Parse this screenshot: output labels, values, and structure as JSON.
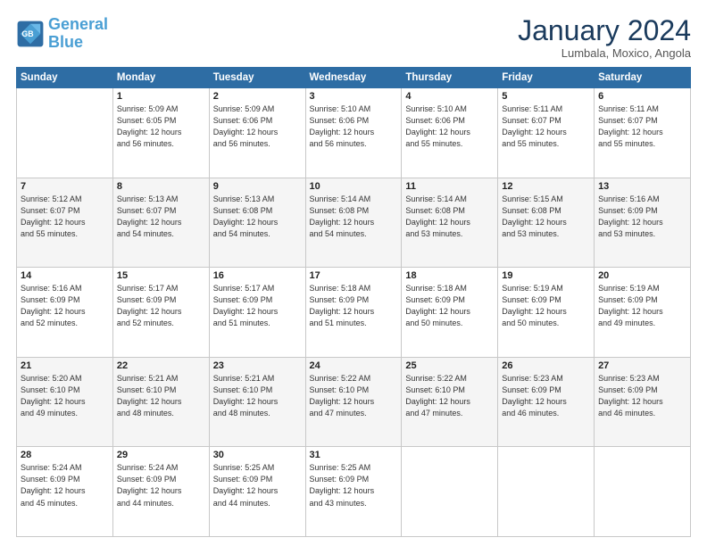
{
  "logo": {
    "line1": "General",
    "line2": "Blue"
  },
  "header": {
    "title": "January 2024",
    "subtitle": "Lumbala, Moxico, Angola"
  },
  "weekdays": [
    "Sunday",
    "Monday",
    "Tuesday",
    "Wednesday",
    "Thursday",
    "Friday",
    "Saturday"
  ],
  "weeks": [
    [
      {
        "day": "",
        "info": ""
      },
      {
        "day": "1",
        "info": "Sunrise: 5:09 AM\nSunset: 6:05 PM\nDaylight: 12 hours\nand 56 minutes."
      },
      {
        "day": "2",
        "info": "Sunrise: 5:09 AM\nSunset: 6:06 PM\nDaylight: 12 hours\nand 56 minutes."
      },
      {
        "day": "3",
        "info": "Sunrise: 5:10 AM\nSunset: 6:06 PM\nDaylight: 12 hours\nand 56 minutes."
      },
      {
        "day": "4",
        "info": "Sunrise: 5:10 AM\nSunset: 6:06 PM\nDaylight: 12 hours\nand 55 minutes."
      },
      {
        "day": "5",
        "info": "Sunrise: 5:11 AM\nSunset: 6:07 PM\nDaylight: 12 hours\nand 55 minutes."
      },
      {
        "day": "6",
        "info": "Sunrise: 5:11 AM\nSunset: 6:07 PM\nDaylight: 12 hours\nand 55 minutes."
      }
    ],
    [
      {
        "day": "7",
        "info": "Sunrise: 5:12 AM\nSunset: 6:07 PM\nDaylight: 12 hours\nand 55 minutes."
      },
      {
        "day": "8",
        "info": "Sunrise: 5:13 AM\nSunset: 6:07 PM\nDaylight: 12 hours\nand 54 minutes."
      },
      {
        "day": "9",
        "info": "Sunrise: 5:13 AM\nSunset: 6:08 PM\nDaylight: 12 hours\nand 54 minutes."
      },
      {
        "day": "10",
        "info": "Sunrise: 5:14 AM\nSunset: 6:08 PM\nDaylight: 12 hours\nand 54 minutes."
      },
      {
        "day": "11",
        "info": "Sunrise: 5:14 AM\nSunset: 6:08 PM\nDaylight: 12 hours\nand 53 minutes."
      },
      {
        "day": "12",
        "info": "Sunrise: 5:15 AM\nSunset: 6:08 PM\nDaylight: 12 hours\nand 53 minutes."
      },
      {
        "day": "13",
        "info": "Sunrise: 5:16 AM\nSunset: 6:09 PM\nDaylight: 12 hours\nand 53 minutes."
      }
    ],
    [
      {
        "day": "14",
        "info": "Sunrise: 5:16 AM\nSunset: 6:09 PM\nDaylight: 12 hours\nand 52 minutes."
      },
      {
        "day": "15",
        "info": "Sunrise: 5:17 AM\nSunset: 6:09 PM\nDaylight: 12 hours\nand 52 minutes."
      },
      {
        "day": "16",
        "info": "Sunrise: 5:17 AM\nSunset: 6:09 PM\nDaylight: 12 hours\nand 51 minutes."
      },
      {
        "day": "17",
        "info": "Sunrise: 5:18 AM\nSunset: 6:09 PM\nDaylight: 12 hours\nand 51 minutes."
      },
      {
        "day": "18",
        "info": "Sunrise: 5:18 AM\nSunset: 6:09 PM\nDaylight: 12 hours\nand 50 minutes."
      },
      {
        "day": "19",
        "info": "Sunrise: 5:19 AM\nSunset: 6:09 PM\nDaylight: 12 hours\nand 50 minutes."
      },
      {
        "day": "20",
        "info": "Sunrise: 5:19 AM\nSunset: 6:09 PM\nDaylight: 12 hours\nand 49 minutes."
      }
    ],
    [
      {
        "day": "21",
        "info": "Sunrise: 5:20 AM\nSunset: 6:10 PM\nDaylight: 12 hours\nand 49 minutes."
      },
      {
        "day": "22",
        "info": "Sunrise: 5:21 AM\nSunset: 6:10 PM\nDaylight: 12 hours\nand 48 minutes."
      },
      {
        "day": "23",
        "info": "Sunrise: 5:21 AM\nSunset: 6:10 PM\nDaylight: 12 hours\nand 48 minutes."
      },
      {
        "day": "24",
        "info": "Sunrise: 5:22 AM\nSunset: 6:10 PM\nDaylight: 12 hours\nand 47 minutes."
      },
      {
        "day": "25",
        "info": "Sunrise: 5:22 AM\nSunset: 6:10 PM\nDaylight: 12 hours\nand 47 minutes."
      },
      {
        "day": "26",
        "info": "Sunrise: 5:23 AM\nSunset: 6:09 PM\nDaylight: 12 hours\nand 46 minutes."
      },
      {
        "day": "27",
        "info": "Sunrise: 5:23 AM\nSunset: 6:09 PM\nDaylight: 12 hours\nand 46 minutes."
      }
    ],
    [
      {
        "day": "28",
        "info": "Sunrise: 5:24 AM\nSunset: 6:09 PM\nDaylight: 12 hours\nand 45 minutes."
      },
      {
        "day": "29",
        "info": "Sunrise: 5:24 AM\nSunset: 6:09 PM\nDaylight: 12 hours\nand 44 minutes."
      },
      {
        "day": "30",
        "info": "Sunrise: 5:25 AM\nSunset: 6:09 PM\nDaylight: 12 hours\nand 44 minutes."
      },
      {
        "day": "31",
        "info": "Sunrise: 5:25 AM\nSunset: 6:09 PM\nDaylight: 12 hours\nand 43 minutes."
      },
      {
        "day": "",
        "info": ""
      },
      {
        "day": "",
        "info": ""
      },
      {
        "day": "",
        "info": ""
      }
    ]
  ]
}
